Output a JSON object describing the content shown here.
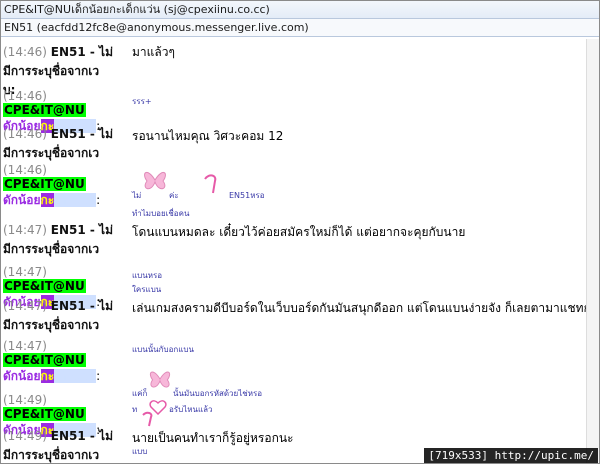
{
  "header": {
    "title": "CPE&IT@NUเด็กน้อยกะเด็กแว่น (sj@cpexiinu.co.cc)",
    "participant": "EN51 (eacfdd12fc8e@anonymous.messenger.live.com)"
  },
  "sender_a": {
    "name_line1": "EN51 - ไม่",
    "name_line2": "มีการระบุชื่อจากเว",
    "name_line3": "บ:"
  },
  "sender_b": {
    "tag": "CPE&IT@NU",
    "line2_a": "ดักน้อย",
    "line2_b": "กะ",
    "line2_c": "เด็กแว่น",
    "line2_d": ":"
  },
  "messages": [
    {
      "time": "(14:46)",
      "text": "มาแล้วๆ"
    },
    {
      "time": "(14:46)",
      "text": "รรร+"
    },
    {
      "time": "(14:46)",
      "text": "รอนานไหมคุณ วิศวะคอม 12"
    },
    {
      "time": "(14:46)",
      "text_a": "ไม่",
      "text_b": "ค่ะ",
      "text_c": "EN51หรอ",
      "text_d": "ทำไมบอยเชื่อคน"
    },
    {
      "time": "(14:47)",
      "text": "โดนแบนหมดละ เดี๋ยวไว้ค่อยสมัครใหม่ก็ได้ แต่อยากจะคุยกับนาย"
    },
    {
      "time": "(14:47)",
      "text_a": "แบนหรอ",
      "text_b": "ใครแบน"
    },
    {
      "time": "(14:47)",
      "text": "เล่นเกมสงครามดีบีบอร์ดในเว็บบอร์ดกันมันสนุกดีออก แต่โดนแบนง่ายจัง ก็เลยตามาแชทกันดีกว่า"
    },
    {
      "time": "(14:47)",
      "text": "แบนนั้นกับอกแบน"
    },
    {
      "time": "(14:49)",
      "text_a": "แค่ก็",
      "text_b": "นั้นมันบอกรหัสด้วยไช่หรอ",
      "text_c": "ท",
      "text_d": "อรับไหนแล้ว"
    },
    {
      "time": "(14:49)",
      "text": "นายเป็นคนทำเราก็รู้อยู่หรอกนะ",
      "text2": "แบบ"
    }
  ],
  "watermark": "[719x533] http://upic.me/"
}
